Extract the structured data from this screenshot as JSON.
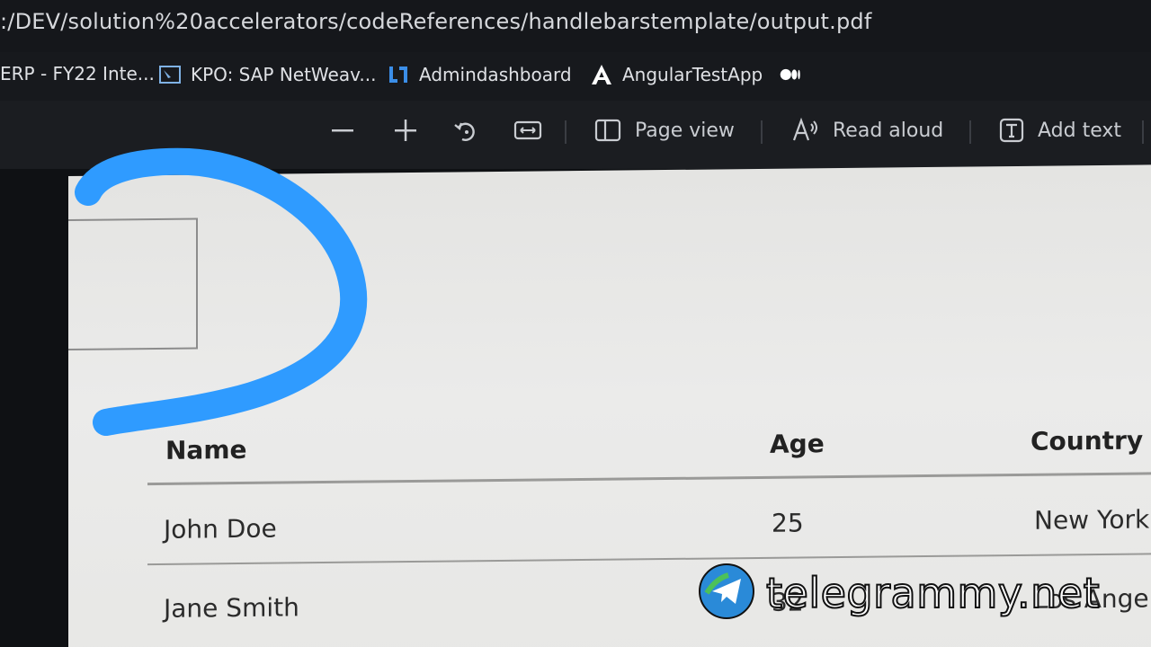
{
  "address_bar": {
    "url": ":/DEV/solution%20accelerators/codeReferences/handlebarstemplate/output.pdf"
  },
  "bookmarks": [
    {
      "label": "ERP - FY22 Inte...",
      "icon": "bookmark-erp-icon"
    },
    {
      "label": "KPO: SAP NetWeav...",
      "icon": "sap-netweaver-icon"
    },
    {
      "label": "Admindashboard",
      "icon": "admindashboard-icon"
    },
    {
      "label": "AngularTestApp",
      "icon": "angular-icon"
    },
    {
      "label": "",
      "icon": "medium-icon"
    }
  ],
  "pdf_toolbar": {
    "zoom_out_icon": "minus-icon",
    "zoom_in_icon": "plus-icon",
    "rotate_icon": "rotate-icon",
    "fit_icon": "fit-width-icon",
    "page_view_label": "Page view",
    "read_aloud_label": "Read aloud",
    "add_text_label": "Add text"
  },
  "table": {
    "headers": [
      "Name",
      "Age",
      "Country"
    ],
    "rows": [
      [
        "John Doe",
        "25",
        "New York"
      ],
      [
        "Jane Smith",
        "32",
        "Los Ange"
      ]
    ]
  },
  "watermark": {
    "text": "telegrammy.net"
  },
  "colors": {
    "pen_stroke": "#2f9bff",
    "toolbar_bg": "#1b1d21",
    "page_bg": "#e9e9e7"
  }
}
